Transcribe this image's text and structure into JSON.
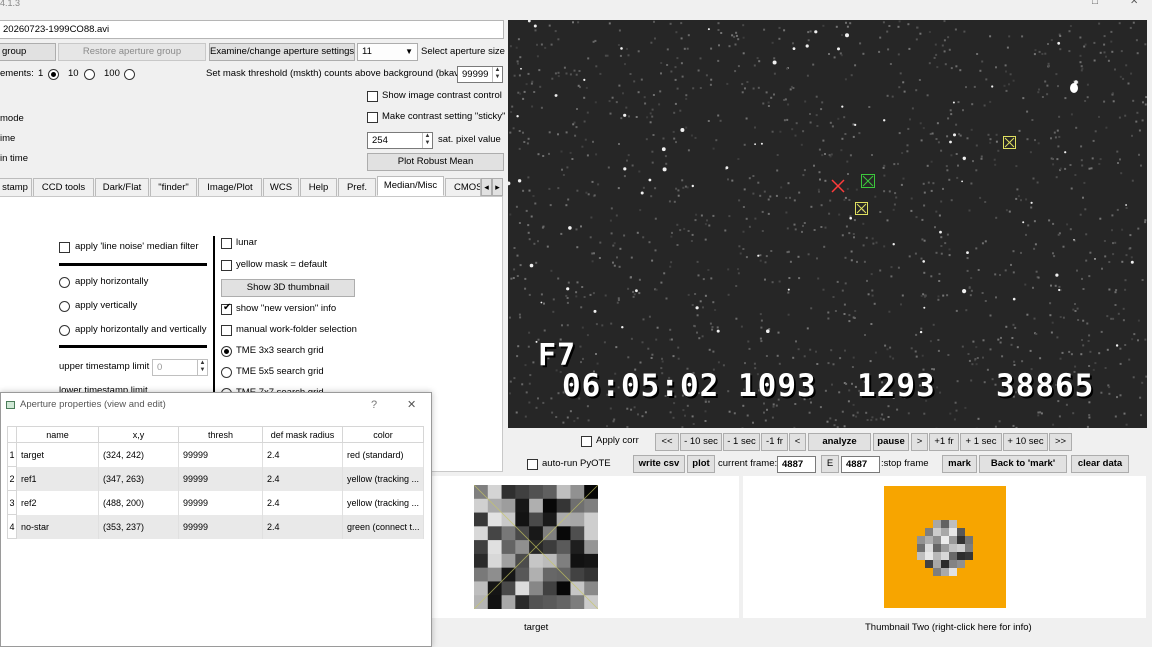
{
  "window": {
    "title_fragment": "4.1.3",
    "controls": {
      "restore": "□",
      "close": "✕"
    }
  },
  "file_path": "20260723-1999CO88.avi",
  "aperture_row": {
    "group_label": "group",
    "restore_label": "Restore aperture group",
    "examine_label": "Examine/change aperture settings",
    "size_value": "11",
    "size_label": "Select aperture size"
  },
  "increments": {
    "label": "ements:",
    "options": [
      "1",
      "10",
      "100"
    ],
    "selected": "1"
  },
  "mask": {
    "label": "Set mask threshold (mskth) counts above background (bkavg)",
    "value": "99999"
  },
  "left_fragments": {
    "mode": "mode",
    "time": "ime",
    "in_time": "in time"
  },
  "contrast": {
    "show_label": "Show image contrast control",
    "sticky_label": "Make contrast setting \"sticky\"",
    "sat_value": "254",
    "sat_label": "sat. pixel value",
    "robust_mean_label": "Plot Robust Mean"
  },
  "tabs": [
    {
      "label": "stamp"
    },
    {
      "label": "CCD tools"
    },
    {
      "label": "Dark/Flat"
    },
    {
      "label": "\"finder\""
    },
    {
      "label": "Image/Plot"
    },
    {
      "label": "WCS"
    },
    {
      "label": "Help"
    },
    {
      "label": "Pref."
    },
    {
      "label": "Median/Misc"
    },
    {
      "label": "CMOS"
    }
  ],
  "tab_scroll": {
    "left": "◂",
    "right": "▸"
  },
  "median_panel": {
    "line_noise_label": "apply 'line noise' median filter",
    "apply_options": [
      "apply horizontally",
      "apply vertically",
      "apply horizontally and vertically"
    ],
    "upper_ts_label": "upper timestamp limit",
    "upper_ts_value": "0",
    "lower_ts_label": "lower timestamp limit"
  },
  "misc_panel": {
    "lunar_label": "lunar",
    "yellow_mask_label": "yellow mask = default",
    "show_3d_label": "Show 3D thumbnail",
    "new_version_label": "show \"new version\" info",
    "new_version_checked": true,
    "manual_folder_label": "manual work-folder selection",
    "tme3_label": "TME 3x3 search grid",
    "tme5_label": "TME 5x5 search grid",
    "tme7_label": "TME 7x7 search grid"
  },
  "dialog": {
    "title": "Aperture properties (view and edit)",
    "help": "?",
    "close": "✕",
    "columns": [
      "name",
      "x,y",
      "thresh",
      "def mask radius",
      "color"
    ],
    "rows": [
      {
        "num": "1",
        "name": "target",
        "xy": "(324, 242)",
        "thresh": "99999",
        "radius": "2.4",
        "color": "red (standard)"
      },
      {
        "num": "2",
        "name": "ref1",
        "xy": "(347, 263)",
        "thresh": "99999",
        "radius": "2.4",
        "color": "yellow (tracking ..."
      },
      {
        "num": "3",
        "name": "ref2",
        "xy": "(488, 200)",
        "thresh": "99999",
        "radius": "2.4",
        "color": "yellow (tracking ..."
      },
      {
        "num": "4",
        "name": "no-star",
        "xy": "(353, 237)",
        "thresh": "99999",
        "radius": "2.4",
        "color": "green (connect t..."
      }
    ]
  },
  "video_overlay": {
    "label": "F7",
    "time": "06:05:02",
    "field1": "1093",
    "field2": "1293",
    "field3": "38865"
  },
  "playback": {
    "apply_corr_label": "Apply corr",
    "buttons": [
      "<<",
      "- 10 sec",
      "- 1 sec",
      "-1 fr",
      "<",
      "analyze",
      "pause",
      ">",
      "+1 fr",
      "+ 1 sec",
      "+ 10 sec",
      ">>"
    ]
  },
  "frame_controls": {
    "auto_run_label": "auto-run PyOTE",
    "write_csv": "write csv",
    "plot": "plot",
    "current_frame_label": "current frame:",
    "current_frame_value": "4887",
    "e_label": "E",
    "stop_frame_value": "4887",
    "stop_frame_label": ":stop frame",
    "mark": "mark",
    "back_to_mark": "Back to 'mark'",
    "clear_data": "clear data"
  },
  "thumbnails": {
    "one_label": "target",
    "two_label": "Thumbnail Two (right-click here for info)",
    "two_bg_color": "#f7a500"
  },
  "colors": {
    "target_marker": "#ff3b3b",
    "ref_marker": "#e0e060",
    "nostar_marker": "#3cc83c"
  }
}
